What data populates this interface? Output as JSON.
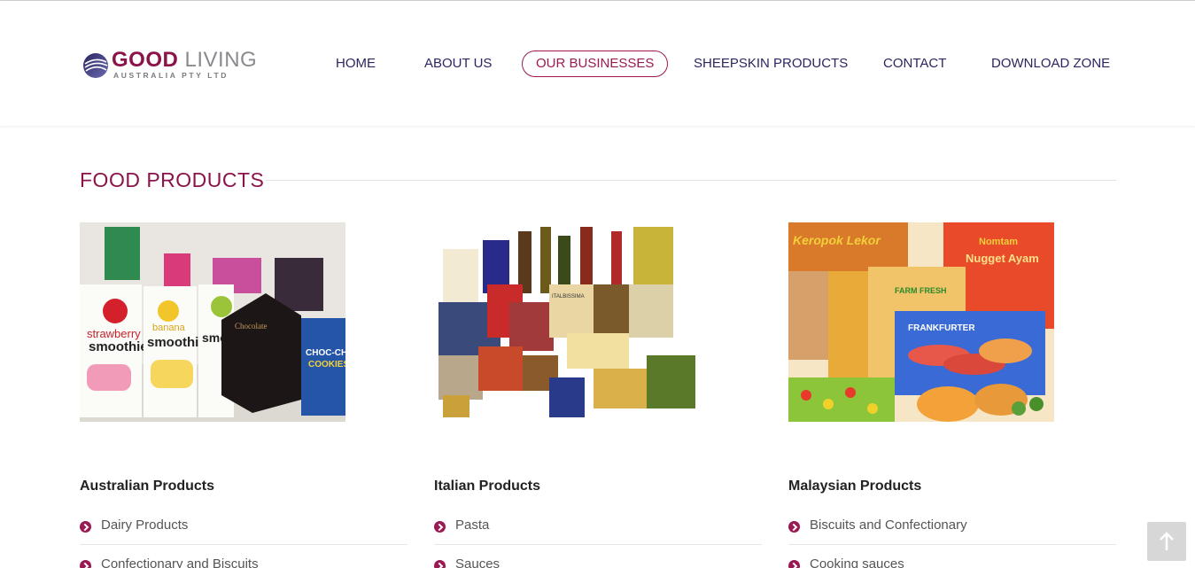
{
  "logo": {
    "brand_primary": "GOOD",
    "brand_secondary": "LIVING",
    "tagline": "AUSTRALIA PTY LTD"
  },
  "nav": {
    "items": [
      {
        "label": "HOME",
        "active": false
      },
      {
        "label": "ABOUT US",
        "active": false
      },
      {
        "label": "OUR BUSINESSES",
        "active": true
      },
      {
        "label": "SHEEPSKIN PRODUCTS",
        "active": false
      },
      {
        "label": "CONTACT",
        "active": false
      },
      {
        "label": "DOWNLOAD ZONE",
        "active": false
      }
    ]
  },
  "section": {
    "title": "FOOD PRODUCTS"
  },
  "columns": [
    {
      "title": "Australian Products",
      "items": [
        "Dairy Products",
        "Confectionary and Biscuits"
      ]
    },
    {
      "title": "Italian Products",
      "items": [
        "Pasta",
        "Sauces"
      ]
    },
    {
      "title": "Malaysian Products",
      "items": [
        "Biscuits and Confectionary",
        "Cooking sauces"
      ]
    }
  ],
  "images": [
    {
      "icon": "smoothie-boxes-photo",
      "labels": [
        "strawberry smoothie",
        "banana smoothie",
        "CHOC-CHIP COOKIES"
      ]
    },
    {
      "icon": "italian-groceries-photo",
      "labels": [
        "ITALBISSIMA"
      ]
    },
    {
      "icon": "frozen-foods-photo",
      "labels": [
        "Keropok Lekor",
        "Nugget Ayam",
        "FRANKFURTER"
      ]
    }
  ],
  "back_to_top": {
    "icon": "arrow-up-icon"
  },
  "colors": {
    "accent": "#9a1a52",
    "nav_text": "#2b2660",
    "title": "#8c1349"
  }
}
